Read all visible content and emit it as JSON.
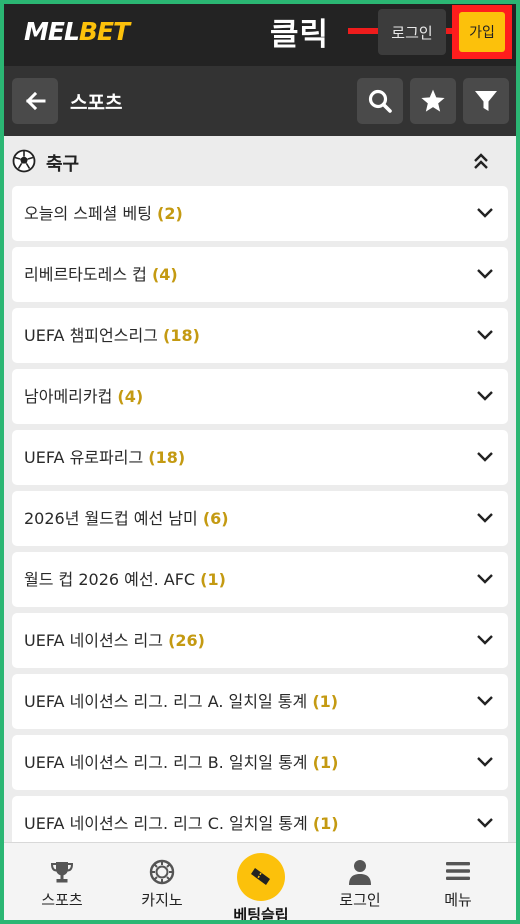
{
  "header": {
    "logo_part1": "MEL",
    "logo_part2": "BET",
    "annotation": "클릭",
    "login_label": "로그인",
    "signup_label": "가입"
  },
  "subheader": {
    "title": "스포츠",
    "icons": [
      "back-arrow-icon",
      "search-icon",
      "star-icon",
      "filter-icon"
    ]
  },
  "sport": {
    "title": "축구",
    "icon": "soccer-ball-icon"
  },
  "leagues": [
    {
      "name": "오늘의 스페셜 베팅",
      "count": "(2)"
    },
    {
      "name": "리베르타도레스 컵",
      "count": "(4)"
    },
    {
      "name": "UEFA 챔피언스리그",
      "count": "(18)"
    },
    {
      "name": "남아메리카컵",
      "count": "(4)"
    },
    {
      "name": "UEFA 유로파리그",
      "count": "(18)"
    },
    {
      "name": "2026년 월드컵 예선 남미",
      "count": "(6)"
    },
    {
      "name": "월드 컵 2026 예선. AFC",
      "count": "(1)"
    },
    {
      "name": "UEFA 네이션스 리그",
      "count": "(26)"
    },
    {
      "name": "UEFA 네이션스 리그. 리그 A. 일치일 통계",
      "count": "(1)"
    },
    {
      "name": "UEFA 네이션스 리그. 리그 B. 일치일 통계",
      "count": "(1)"
    },
    {
      "name": "UEFA 네이션스 리그. 리그 C. 일치일 통계",
      "count": "(1)"
    }
  ],
  "bottom_nav": {
    "sports": "스포츠",
    "casino": "카지노",
    "betslip": "베팅슬립",
    "login": "로그인",
    "menu": "메뉴"
  },
  "colors": {
    "accent": "#fcc10b",
    "count": "#c49a12",
    "header_bg": "#232323",
    "subheader_bg": "#333333",
    "annotation_red": "#ff1d1d",
    "page_border": "#2bb673"
  }
}
